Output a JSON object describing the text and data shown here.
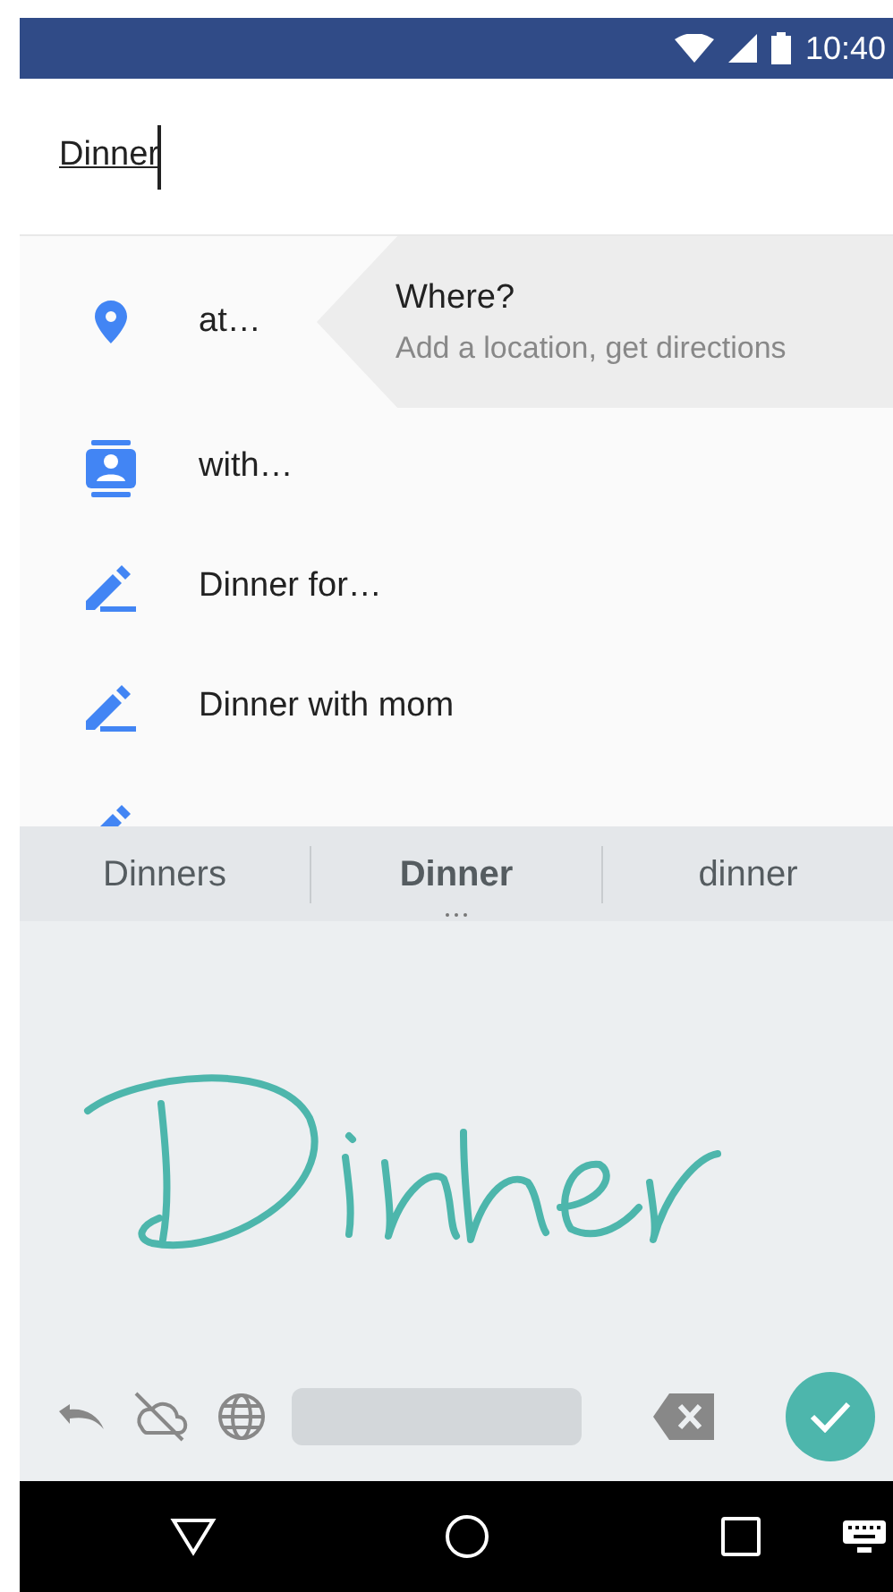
{
  "status_bar": {
    "time": "10:40"
  },
  "input": {
    "value": "Dinner"
  },
  "suggestions": [
    {
      "kind": "location",
      "label": "at…",
      "hint": {
        "title": "Where?",
        "subtitle": "Add a location, get directions"
      }
    },
    {
      "kind": "contact",
      "label": "with…"
    },
    {
      "kind": "edit",
      "label": "Dinner for…"
    },
    {
      "kind": "edit",
      "label": "Dinner with mom"
    },
    {
      "kind": "edit"
    }
  ],
  "candidates": [
    {
      "label": "Dinners",
      "selected": false
    },
    {
      "label": "Dinner",
      "selected": true
    },
    {
      "label": "dinner",
      "selected": false
    }
  ]
}
